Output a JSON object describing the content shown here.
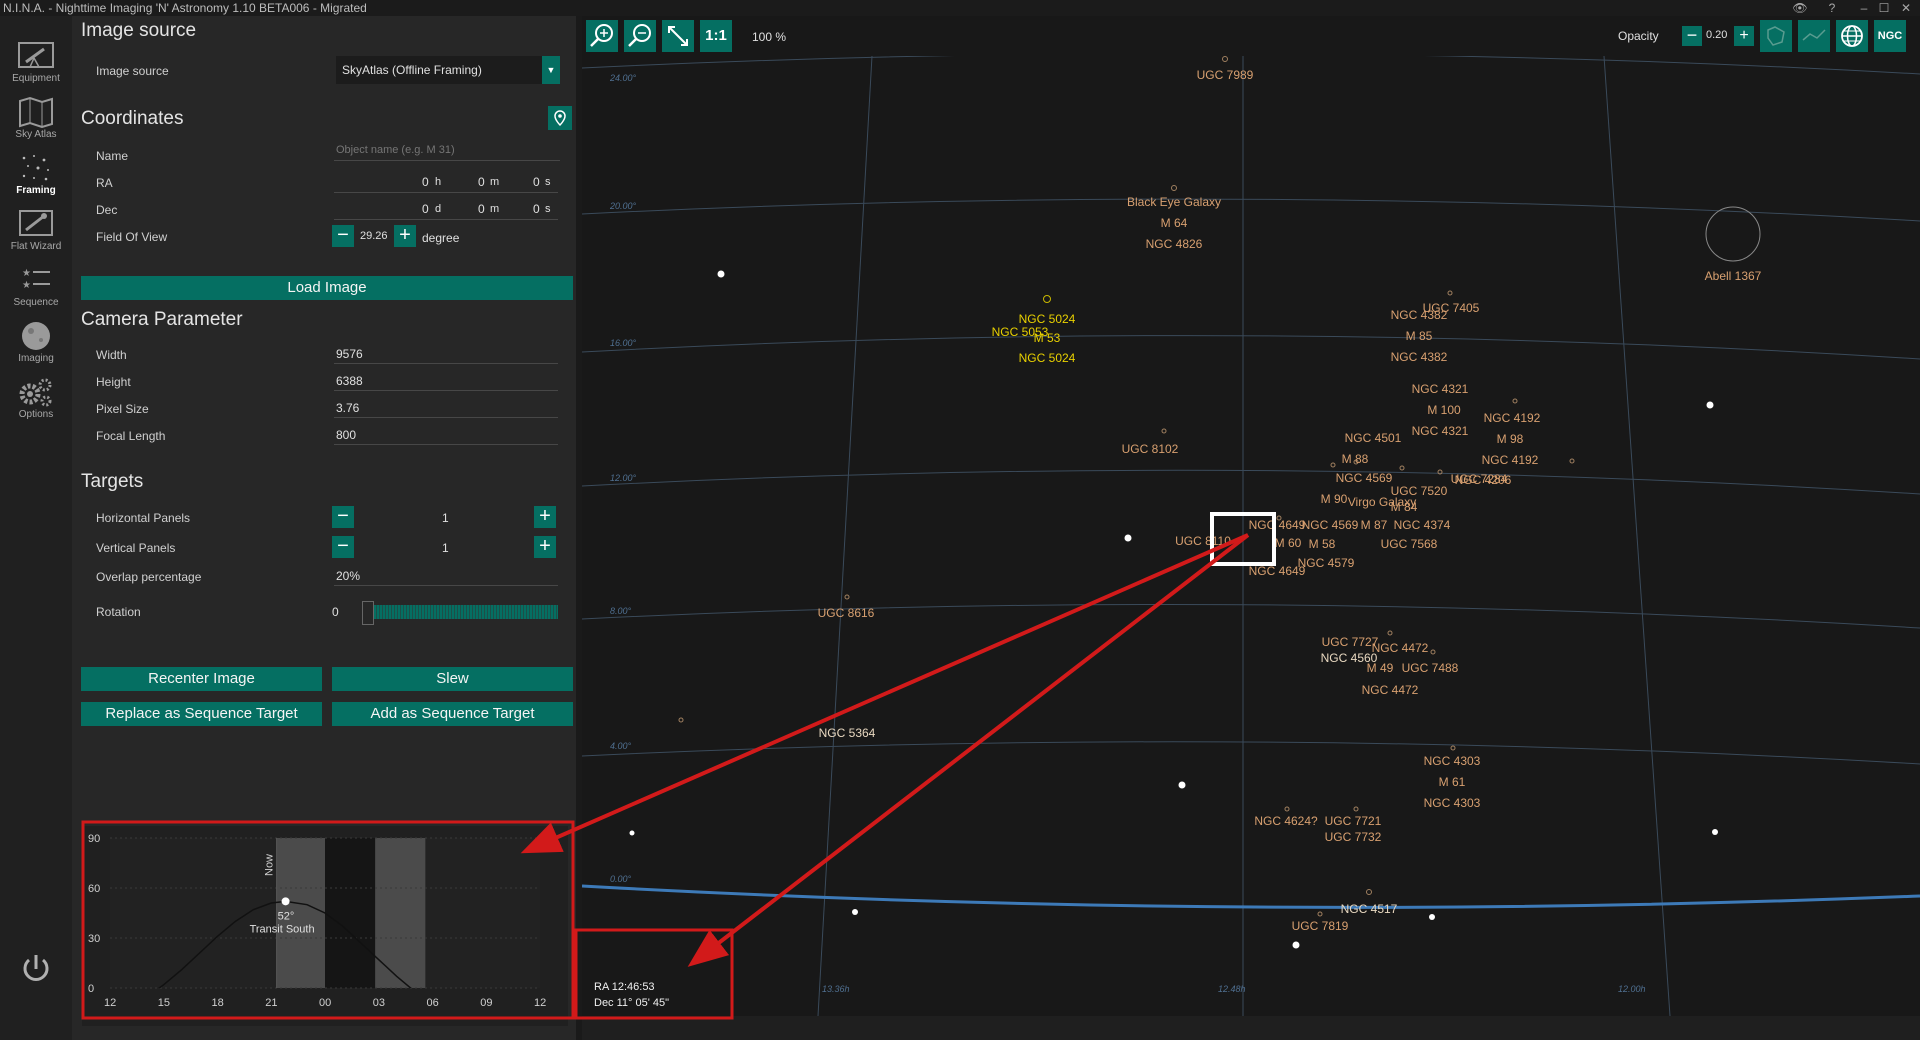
{
  "window": {
    "title": "N.I.N.A. - Nighttime Imaging 'N' Astronomy 1.10 BETA006  -  Migrated"
  },
  "nav": [
    {
      "label": "Equipment",
      "icon": "telescope-icon"
    },
    {
      "label": "Sky Atlas",
      "icon": "atlas-icon"
    },
    {
      "label": "Framing",
      "icon": "framing-icon"
    },
    {
      "label": "Flat Wizard",
      "icon": "flat-wizard-icon"
    },
    {
      "label": "Sequence",
      "icon": "sequence-icon"
    },
    {
      "label": "Imaging",
      "icon": "imaging-icon"
    },
    {
      "label": "Options",
      "icon": "options-icon"
    }
  ],
  "image_source": {
    "title": "Image source",
    "label": "Image source",
    "value": "SkyAtlas (Offline Framing)"
  },
  "coordinates": {
    "title": "Coordinates",
    "name_label": "Name",
    "name_placeholder": "Object name (e.g. M 31)",
    "ra_label": "RA",
    "ra_h": "0",
    "ra_h_unit": "h",
    "ra_m": "0",
    "ra_m_unit": "m",
    "ra_s": "0",
    "ra_s_unit": "s",
    "dec_label": "Dec",
    "dec_d": "0",
    "dec_d_unit": "d",
    "dec_m": "0",
    "dec_m_unit": "m",
    "dec_s": "0",
    "dec_s_unit": "s",
    "fov_label": "Field Of View",
    "fov_value": "29.26",
    "fov_unit": "degree"
  },
  "load_image": "Load Image",
  "camera": {
    "title": "Camera Parameter",
    "width_label": "Width",
    "width": "9576",
    "height_label": "Height",
    "height": "6388",
    "pixel_label": "Pixel Size",
    "pixel": "3.76",
    "focal_label": "Focal Length",
    "focal": "800"
  },
  "targets": {
    "title": "Targets",
    "hpanels_label": "Horizontal Panels",
    "hpanels": "1",
    "vpanels_label": "Vertical Panels",
    "vpanels": "1",
    "overlap_label": "Overlap percentage",
    "overlap": "20%",
    "rotation_label": "Rotation",
    "rotation": "0"
  },
  "buttons": {
    "recenter": "Recenter Image",
    "slew": "Slew",
    "replace": "Replace as Sequence Target",
    "add": "Add as Sequence Target"
  },
  "chart_data": {
    "type": "line",
    "x_ticks": [
      "12",
      "15",
      "18",
      "21",
      "00",
      "03",
      "06",
      "09",
      "12"
    ],
    "y_ticks": [
      "90",
      "60",
      "30",
      "0"
    ],
    "ylim": [
      0,
      90
    ],
    "now_label": "Now",
    "transit_altitude": "52°",
    "transit_label": "Transit South",
    "altitude_curve": [
      [
        0,
        -20
      ],
      [
        1,
        -14
      ],
      [
        2,
        -6
      ],
      [
        3,
        2
      ],
      [
        4,
        11
      ],
      [
        5,
        21
      ],
      [
        6,
        31
      ],
      [
        7,
        40
      ],
      [
        8,
        47
      ],
      [
        9,
        51
      ],
      [
        9.8,
        52
      ],
      [
        11,
        50
      ],
      [
        12,
        45
      ],
      [
        13,
        37
      ],
      [
        14,
        27
      ],
      [
        15,
        17
      ],
      [
        16,
        7
      ],
      [
        17,
        -2
      ]
    ]
  },
  "map": {
    "zoom": "100 %",
    "one_to_one": "1:1",
    "opacity_label": "Opacity",
    "opacity_value": "0.20",
    "ngc_button": "NGC",
    "dec_grid": [
      "24.00°",
      "20.00°",
      "16.00°",
      "12.00°",
      "8.00°",
      "4.00°",
      "0.00°"
    ],
    "ra_grid": [
      "13.36h",
      "12.48h",
      "12.00h"
    ],
    "readout_ra": "RA  12:46:53",
    "readout_dec": "Dec  11° 05' 45\"",
    "objects": [
      {
        "text": "UGC 7989",
        "color": "orange"
      },
      {
        "text": "Black Eye Galaxy",
        "color": "orange"
      },
      {
        "text": "M 64",
        "color": "orange"
      },
      {
        "text": "NGC 4826",
        "color": "orange"
      },
      {
        "text": "Abell 1367",
        "color": "orange"
      },
      {
        "text": "NGC 5024",
        "color": "yellow"
      },
      {
        "text": "NGC 5053",
        "color": "yellow"
      },
      {
        "text": "M 53",
        "color": "yellow"
      },
      {
        "text": "NGC 5024",
        "color": "yellow"
      },
      {
        "text": "UGC 7405",
        "color": "orange"
      },
      {
        "text": "NGC 4382",
        "color": "orange"
      },
      {
        "text": "M 85",
        "color": "orange"
      },
      {
        "text": "NGC 4382",
        "color": "orange"
      },
      {
        "text": "NGC 4321",
        "color": "orange"
      },
      {
        "text": "M 100",
        "color": "orange"
      },
      {
        "text": "NGC 4321",
        "color": "orange"
      },
      {
        "text": "NGC 4192",
        "color": "orange"
      },
      {
        "text": "M 98",
        "color": "orange"
      },
      {
        "text": "NGC 4192",
        "color": "orange"
      },
      {
        "text": "UGC 8102",
        "color": "orange"
      },
      {
        "text": "NGC 4501",
        "color": "orange"
      },
      {
        "text": "M 88",
        "color": "orange"
      },
      {
        "text": "NGC 4569",
        "color": "orange"
      },
      {
        "text": "UGC 7520",
        "color": "orange"
      },
      {
        "text": "UGC 7284",
        "color": "orange"
      },
      {
        "text": "NGC 4206",
        "color": "orange"
      },
      {
        "text": "M 90",
        "color": "orange"
      },
      {
        "text": "Virgo Galaxy",
        "color": "orange"
      },
      {
        "text": "M 84",
        "color": "orange"
      },
      {
        "text": "NGC 4649",
        "color": "orange"
      },
      {
        "text": "NGC 4569",
        "color": "orange"
      },
      {
        "text": "M 87",
        "color": "orange"
      },
      {
        "text": "NGC 4374",
        "color": "orange"
      },
      {
        "text": "UGC 8110",
        "color": "orange"
      },
      {
        "text": "M 58",
        "color": "orange"
      },
      {
        "text": "UGC 7568",
        "color": "orange"
      },
      {
        "text": "M 60",
        "color": "orange"
      },
      {
        "text": "NGC 4579",
        "color": "orange"
      },
      {
        "text": "NGC 4649",
        "color": "orange"
      },
      {
        "text": "UGC 8616",
        "color": "orange"
      },
      {
        "text": "UGC 7727",
        "color": "orange"
      },
      {
        "text": "NGC 4472",
        "color": "orange"
      },
      {
        "text": "NGC 4560",
        "color": "white"
      },
      {
        "text": "M 49",
        "color": "orange"
      },
      {
        "text": "UGC 7488",
        "color": "orange"
      },
      {
        "text": "NGC 4472",
        "color": "orange"
      },
      {
        "text": "NGC 5364",
        "color": "white"
      },
      {
        "text": "NGC 4303",
        "color": "orange"
      },
      {
        "text": "M 61",
        "color": "orange"
      },
      {
        "text": "NGC 4303",
        "color": "orange"
      },
      {
        "text": "NGC 4624?",
        "color": "orange"
      },
      {
        "text": "UGC 7721",
        "color": "orange"
      },
      {
        "text": "UGC 7732",
        "color": "orange"
      },
      {
        "text": "NGC 4517",
        "color": "white"
      },
      {
        "text": "UGC 7819",
        "color": "orange"
      }
    ]
  }
}
